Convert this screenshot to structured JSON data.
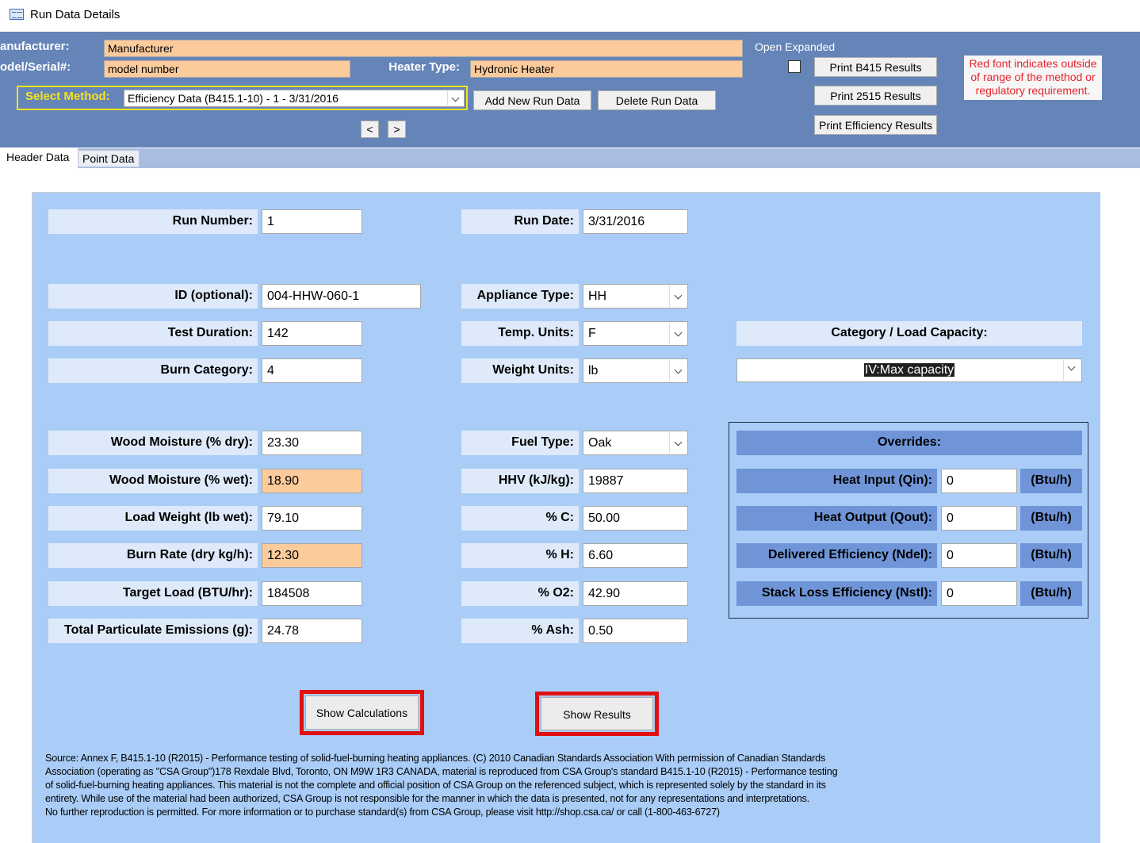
{
  "window": {
    "title": "Run Data Details"
  },
  "header": {
    "manufacturer_label": "anufacturer:",
    "manufacturer_value": "Manufacturer",
    "model_label": "odel/Serial#:",
    "model_value": "model number",
    "heater_type_label": "Heater Type:",
    "heater_type_value": "Hydronic Heater",
    "select_method_label": "Select Method:",
    "select_method_value": "Efficiency Data (B415.1-10) - 1 - 3/31/2016",
    "add_new_run": "Add New Run Data",
    "delete_run": "Delete Run Data",
    "prev": "<",
    "next": ">",
    "open_expanded_label": "Open Expanded",
    "print_b415": "Print B415 Results",
    "print_2515": "Print 2515 Results",
    "print_efficiency": "Print Efficiency Results",
    "red_note": "Red font indicates outside of range of the method or regulatory requirement."
  },
  "tabs": [
    {
      "label": "Header Data"
    },
    {
      "label": "Point Data"
    }
  ],
  "fields": {
    "run_number": {
      "label": "Run Number:",
      "value": "1"
    },
    "run_date": {
      "label": "Run Date:",
      "value": "3/31/2016"
    },
    "id_optional": {
      "label": "ID (optional):",
      "value": "004-HHW-060-1"
    },
    "appliance_type": {
      "label": "Appliance Type:",
      "value": "HH"
    },
    "test_duration": {
      "label": "Test Duration:",
      "value": "142"
    },
    "temp_units": {
      "label": "Temp. Units:",
      "value": "F"
    },
    "burn_category": {
      "label": "Burn Category:",
      "value": "4"
    },
    "weight_units": {
      "label": "Weight Units:",
      "value": "lb"
    },
    "category_load_capacity": {
      "label": "Category / Load Capacity:",
      "value": "IV:Max capacity"
    },
    "wood_moisture_dry": {
      "label": "Wood Moisture (% dry):",
      "value": "23.30"
    },
    "wood_moisture_wet": {
      "label": "Wood Moisture (% wet):",
      "value": "18.90"
    },
    "load_weight": {
      "label": "Load Weight (lb wet):",
      "value": "79.10"
    },
    "burn_rate": {
      "label": "Burn Rate (dry kg/h):",
      "value": "12.30"
    },
    "target_load": {
      "label": "Target Load (BTU/hr):",
      "value": "184508"
    },
    "total_particulate": {
      "label": "Total Particulate Emissions (g):",
      "value": "24.78"
    },
    "fuel_type": {
      "label": "Fuel Type:",
      "value": "Oak"
    },
    "hhv": {
      "label": "HHV (kJ/kg):",
      "value": "19887"
    },
    "pct_c": {
      "label": "% C:",
      "value": "50.00"
    },
    "pct_h": {
      "label": "% H:",
      "value": "6.60"
    },
    "pct_o2": {
      "label": "% O2:",
      "value": "42.90"
    },
    "pct_ash": {
      "label": "% Ash:",
      "value": "0.50"
    }
  },
  "overrides": {
    "title": "Overrides:",
    "rows": [
      {
        "label": "Heat Input (Qin):",
        "value": "0",
        "unit": "(Btu/h)"
      },
      {
        "label": "Heat Output (Qout):",
        "value": "0",
        "unit": "(Btu/h)"
      },
      {
        "label": "Delivered Efficiency  (Ndel):",
        "value": "0",
        "unit": "(Btu/h)"
      },
      {
        "label": "Stack Loss Efficiency (Nstl):",
        "value": "0",
        "unit": "(Btu/h)"
      }
    ]
  },
  "actions": {
    "show_calculations": "Show Calculations",
    "show_results": "Show Results"
  },
  "source": {
    "line1": "Source:  Annex F, B415.1-10 (R2015) - Performance testing of solid-fuel-burning heating appliances.  (C) 2010 Canadian Standards Association  With permission of Canadian Standards",
    "line2": "Association (operating as \"CSA Group\")178 Rexdale Blvd, Toronto, ON  M9W 1R3 CANADA, material is reproduced from CSA Group's standard B415.1-10 (R2015) - Performance testing",
    "line3": "of solid-fuel-burning heating appliances.  This material is not the complete and official position of CSA Group on the referenced subject, which is represented solely by the standard in its",
    "line4": "entirety.  While use of the material had been authorized, CSA Group is not responsible for the manner in which the data is presented, not for any representations and interpretations.",
    "line5": "No further reproduction is permitted.  For more information or to purchase standard(s) from CSA Group, please visit http://shop.csa.ca/ or call (1-800-463-6727)"
  },
  "colors": {
    "header_band": "#6584b8",
    "panel": "#a9cdf7",
    "label_bg": "#deeafa",
    "orange_field": "#fccb9c",
    "overrides_bg": "#6f95d8",
    "highlight_frame": "#e01010",
    "red_note_text": "#e8232a",
    "select_method_border": "#f5e41a"
  },
  "icons": [
    "form-icon",
    "dropdown-arrow-icon",
    "checkbox-icon"
  ]
}
